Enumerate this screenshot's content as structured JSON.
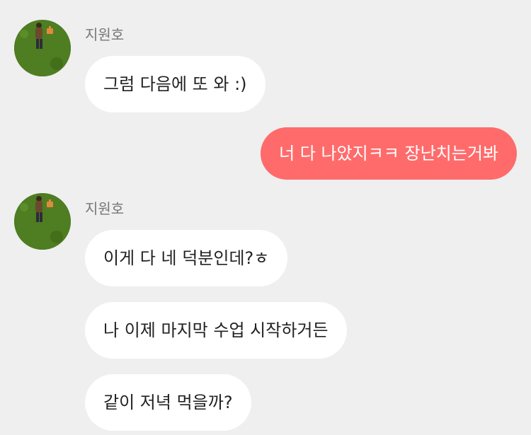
{
  "colors": {
    "background": "#efefef",
    "incoming_bubble": "#ffffff",
    "outgoing_bubble": "#ff6b6b",
    "sender_name": "#777777"
  },
  "messages": [
    {
      "sender": "지원호",
      "text": "그럼 다음에 또 와 :)"
    },
    {
      "sender": "me",
      "text": "너 다 나았지ㅋㅋ 장난치는거봐"
    },
    {
      "sender": "지원호",
      "text": "이게 다 네 덕분인데?ㅎ"
    },
    {
      "sender": "지원호",
      "text": "나 이제 마지막 수업 시작하거든"
    },
    {
      "sender": "지원호",
      "text": "같이 저녁 먹을까?"
    }
  ],
  "groups": [
    {
      "sender_name": "지원호",
      "avatar": "profile-photo-grass"
    },
    {
      "sender_name": "지원호",
      "avatar": "profile-photo-grass"
    }
  ]
}
